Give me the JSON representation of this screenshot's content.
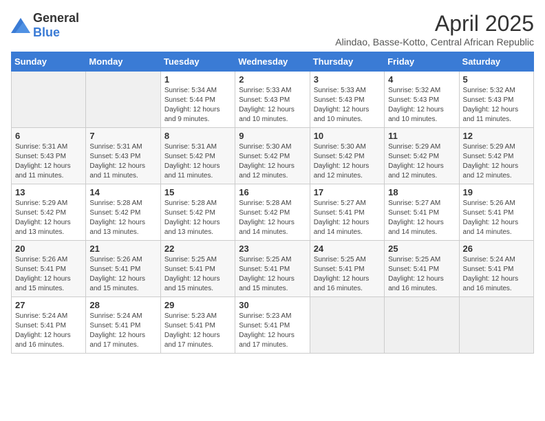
{
  "logo": {
    "general": "General",
    "blue": "Blue"
  },
  "title": "April 2025",
  "subtitle": "Alindao, Basse-Kotto, Central African Republic",
  "days_of_week": [
    "Sunday",
    "Monday",
    "Tuesday",
    "Wednesday",
    "Thursday",
    "Friday",
    "Saturday"
  ],
  "weeks": [
    [
      {
        "day": "",
        "info": ""
      },
      {
        "day": "",
        "info": ""
      },
      {
        "day": "1",
        "info": "Sunrise: 5:34 AM\nSunset: 5:44 PM\nDaylight: 12 hours and 9 minutes."
      },
      {
        "day": "2",
        "info": "Sunrise: 5:33 AM\nSunset: 5:43 PM\nDaylight: 12 hours and 10 minutes."
      },
      {
        "day": "3",
        "info": "Sunrise: 5:33 AM\nSunset: 5:43 PM\nDaylight: 12 hours and 10 minutes."
      },
      {
        "day": "4",
        "info": "Sunrise: 5:32 AM\nSunset: 5:43 PM\nDaylight: 12 hours and 10 minutes."
      },
      {
        "day": "5",
        "info": "Sunrise: 5:32 AM\nSunset: 5:43 PM\nDaylight: 12 hours and 11 minutes."
      }
    ],
    [
      {
        "day": "6",
        "info": "Sunrise: 5:31 AM\nSunset: 5:43 PM\nDaylight: 12 hours and 11 minutes."
      },
      {
        "day": "7",
        "info": "Sunrise: 5:31 AM\nSunset: 5:43 PM\nDaylight: 12 hours and 11 minutes."
      },
      {
        "day": "8",
        "info": "Sunrise: 5:31 AM\nSunset: 5:42 PM\nDaylight: 12 hours and 11 minutes."
      },
      {
        "day": "9",
        "info": "Sunrise: 5:30 AM\nSunset: 5:42 PM\nDaylight: 12 hours and 12 minutes."
      },
      {
        "day": "10",
        "info": "Sunrise: 5:30 AM\nSunset: 5:42 PM\nDaylight: 12 hours and 12 minutes."
      },
      {
        "day": "11",
        "info": "Sunrise: 5:29 AM\nSunset: 5:42 PM\nDaylight: 12 hours and 12 minutes."
      },
      {
        "day": "12",
        "info": "Sunrise: 5:29 AM\nSunset: 5:42 PM\nDaylight: 12 hours and 12 minutes."
      }
    ],
    [
      {
        "day": "13",
        "info": "Sunrise: 5:29 AM\nSunset: 5:42 PM\nDaylight: 12 hours and 13 minutes."
      },
      {
        "day": "14",
        "info": "Sunrise: 5:28 AM\nSunset: 5:42 PM\nDaylight: 12 hours and 13 minutes."
      },
      {
        "day": "15",
        "info": "Sunrise: 5:28 AM\nSunset: 5:42 PM\nDaylight: 12 hours and 13 minutes."
      },
      {
        "day": "16",
        "info": "Sunrise: 5:28 AM\nSunset: 5:42 PM\nDaylight: 12 hours and 14 minutes."
      },
      {
        "day": "17",
        "info": "Sunrise: 5:27 AM\nSunset: 5:41 PM\nDaylight: 12 hours and 14 minutes."
      },
      {
        "day": "18",
        "info": "Sunrise: 5:27 AM\nSunset: 5:41 PM\nDaylight: 12 hours and 14 minutes."
      },
      {
        "day": "19",
        "info": "Sunrise: 5:26 AM\nSunset: 5:41 PM\nDaylight: 12 hours and 14 minutes."
      }
    ],
    [
      {
        "day": "20",
        "info": "Sunrise: 5:26 AM\nSunset: 5:41 PM\nDaylight: 12 hours and 15 minutes."
      },
      {
        "day": "21",
        "info": "Sunrise: 5:26 AM\nSunset: 5:41 PM\nDaylight: 12 hours and 15 minutes."
      },
      {
        "day": "22",
        "info": "Sunrise: 5:25 AM\nSunset: 5:41 PM\nDaylight: 12 hours and 15 minutes."
      },
      {
        "day": "23",
        "info": "Sunrise: 5:25 AM\nSunset: 5:41 PM\nDaylight: 12 hours and 15 minutes."
      },
      {
        "day": "24",
        "info": "Sunrise: 5:25 AM\nSunset: 5:41 PM\nDaylight: 12 hours and 16 minutes."
      },
      {
        "day": "25",
        "info": "Sunrise: 5:25 AM\nSunset: 5:41 PM\nDaylight: 12 hours and 16 minutes."
      },
      {
        "day": "26",
        "info": "Sunrise: 5:24 AM\nSunset: 5:41 PM\nDaylight: 12 hours and 16 minutes."
      }
    ],
    [
      {
        "day": "27",
        "info": "Sunrise: 5:24 AM\nSunset: 5:41 PM\nDaylight: 12 hours and 16 minutes."
      },
      {
        "day": "28",
        "info": "Sunrise: 5:24 AM\nSunset: 5:41 PM\nDaylight: 12 hours and 17 minutes."
      },
      {
        "day": "29",
        "info": "Sunrise: 5:23 AM\nSunset: 5:41 PM\nDaylight: 12 hours and 17 minutes."
      },
      {
        "day": "30",
        "info": "Sunrise: 5:23 AM\nSunset: 5:41 PM\nDaylight: 12 hours and 17 minutes."
      },
      {
        "day": "",
        "info": ""
      },
      {
        "day": "",
        "info": ""
      },
      {
        "day": "",
        "info": ""
      }
    ]
  ]
}
